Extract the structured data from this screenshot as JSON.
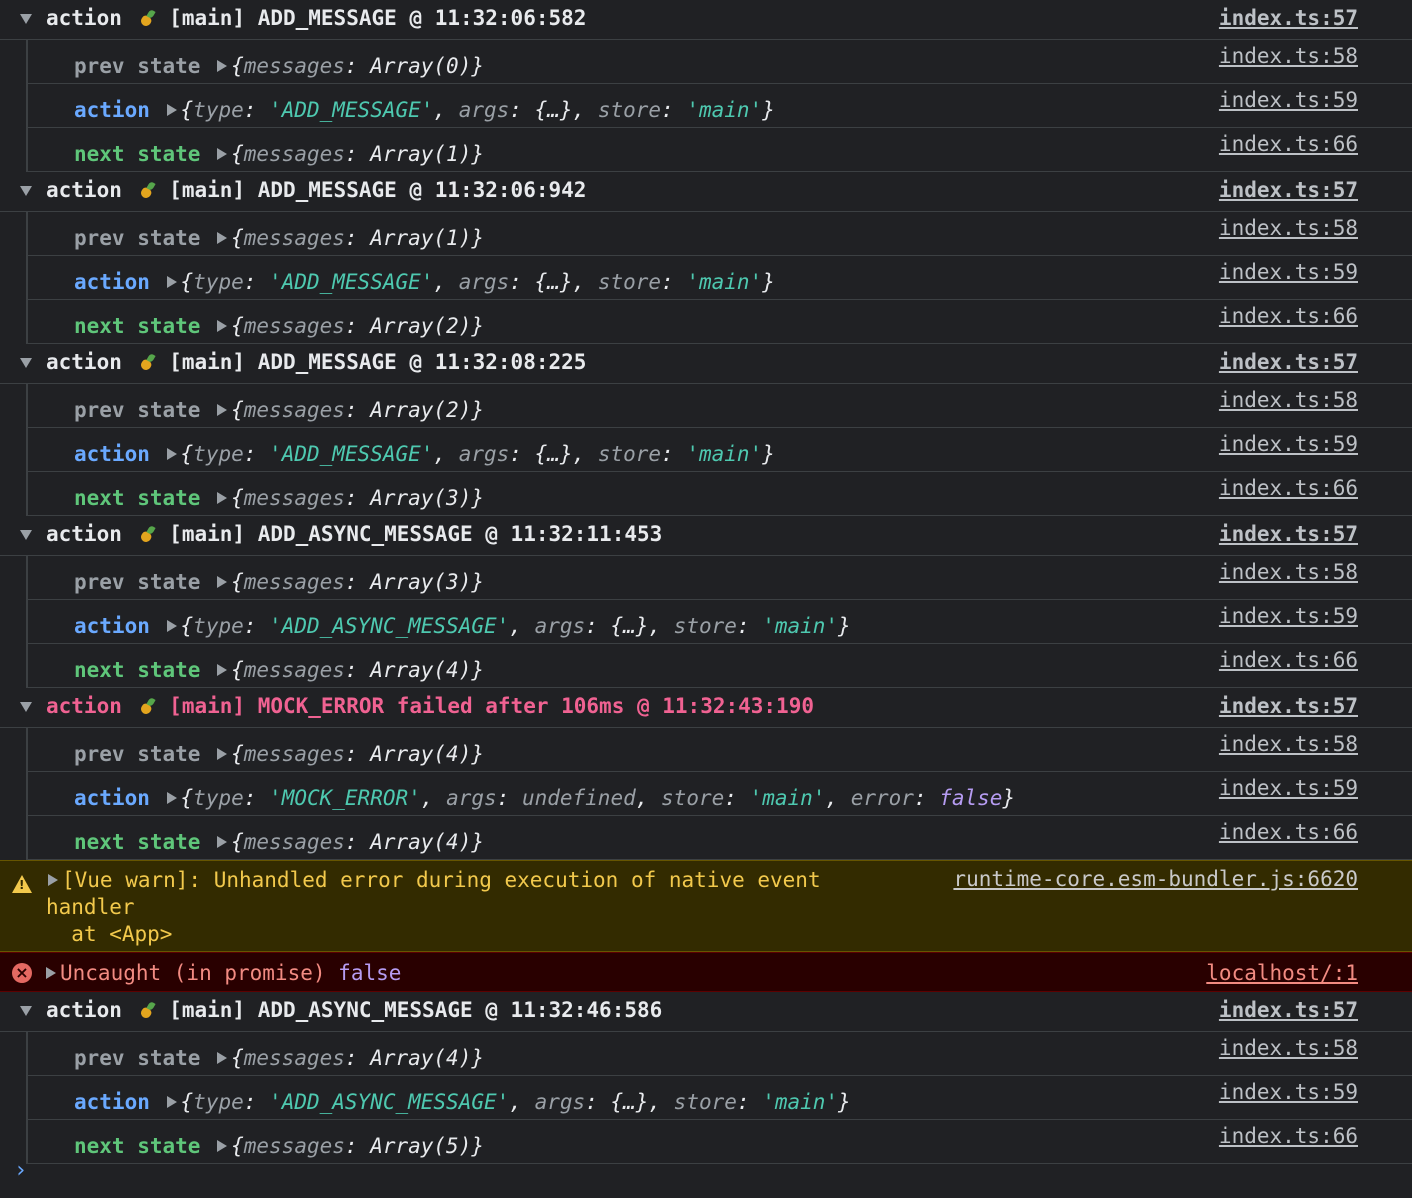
{
  "groups": [
    {
      "label": "action",
      "store": "[main]",
      "title": "ADD_MESSAGE @ 11:32:06:582",
      "error": false,
      "src": "index.ts:57",
      "prev": {
        "label": "prev state",
        "value": "{messages: Array(0)}",
        "src": "index.ts:58"
      },
      "action": {
        "label": "action",
        "type": "'ADD_MESSAGE'",
        "args": "{…}",
        "store": "'main'",
        "src": "index.ts:59"
      },
      "next": {
        "label": "next state",
        "value": "{messages: Array(1)}",
        "src": "index.ts:66"
      }
    },
    {
      "label": "action",
      "store": "[main]",
      "title": "ADD_MESSAGE @ 11:32:06:942",
      "error": false,
      "src": "index.ts:57",
      "prev": {
        "label": "prev state",
        "value": "{messages: Array(1)}",
        "src": "index.ts:58"
      },
      "action": {
        "label": "action",
        "type": "'ADD_MESSAGE'",
        "args": "{…}",
        "store": "'main'",
        "src": "index.ts:59"
      },
      "next": {
        "label": "next state",
        "value": "{messages: Array(2)}",
        "src": "index.ts:66"
      }
    },
    {
      "label": "action",
      "store": "[main]",
      "title": "ADD_MESSAGE @ 11:32:08:225",
      "error": false,
      "src": "index.ts:57",
      "prev": {
        "label": "prev state",
        "value": "{messages: Array(2)}",
        "src": "index.ts:58"
      },
      "action": {
        "label": "action",
        "type": "'ADD_MESSAGE'",
        "args": "{…}",
        "store": "'main'",
        "src": "index.ts:59"
      },
      "next": {
        "label": "next state",
        "value": "{messages: Array(3)}",
        "src": "index.ts:66"
      }
    },
    {
      "label": "action",
      "store": "[main]",
      "title": "ADD_ASYNC_MESSAGE @ 11:32:11:453",
      "error": false,
      "src": "index.ts:57",
      "prev": {
        "label": "prev state",
        "value": "{messages: Array(3)}",
        "src": "index.ts:58"
      },
      "action": {
        "label": "action",
        "type": "'ADD_ASYNC_MESSAGE'",
        "args": "{…}",
        "store": "'main'",
        "src": "index.ts:59"
      },
      "next": {
        "label": "next state",
        "value": "{messages: Array(4)}",
        "src": "index.ts:66"
      }
    },
    {
      "label": "action",
      "store": "[main]",
      "title": "MOCK_ERROR failed after 106ms @ 11:32:43:190",
      "error": true,
      "src": "index.ts:57",
      "prev": {
        "label": "prev state",
        "value": "{messages: Array(4)}",
        "src": "index.ts:58"
      },
      "action": {
        "label": "action",
        "type": "'MOCK_ERROR'",
        "args": "undefined",
        "store": "'main'",
        "errorVal": "false",
        "src": "index.ts:59"
      },
      "next": {
        "label": "next state",
        "value": "{messages: Array(4)}",
        "src": "index.ts:66"
      }
    }
  ],
  "warning": {
    "text": "[Vue warn]: Unhandled error during execution of native event handler\n  at <App>",
    "src": "runtime-core.esm-bundler.js:6620"
  },
  "error": {
    "text": "Uncaught (in promise)",
    "value": "false",
    "src": "localhost/:1"
  },
  "last_group": {
    "label": "action",
    "store": "[main]",
    "title": "ADD_ASYNC_MESSAGE @ 11:32:46:586",
    "src": "index.ts:57",
    "prev": {
      "label": "prev state",
      "value": "{messages: Array(4)}",
      "src": "index.ts:58"
    },
    "action": {
      "label": "action",
      "type": "'ADD_ASYNC_MESSAGE'",
      "args": "{…}",
      "store": "'main'",
      "src": "index.ts:59"
    },
    "next": {
      "label": "next state",
      "value": "{messages: Array(5)}",
      "src": "index.ts:66"
    }
  },
  "prompt": "›",
  "colors": {
    "background": "#202124",
    "action_label": "#6aa9ff",
    "next_label": "#5fc67a",
    "error_text": "#f06292",
    "warning_bg": "#332b00",
    "error_bg": "#290000"
  }
}
